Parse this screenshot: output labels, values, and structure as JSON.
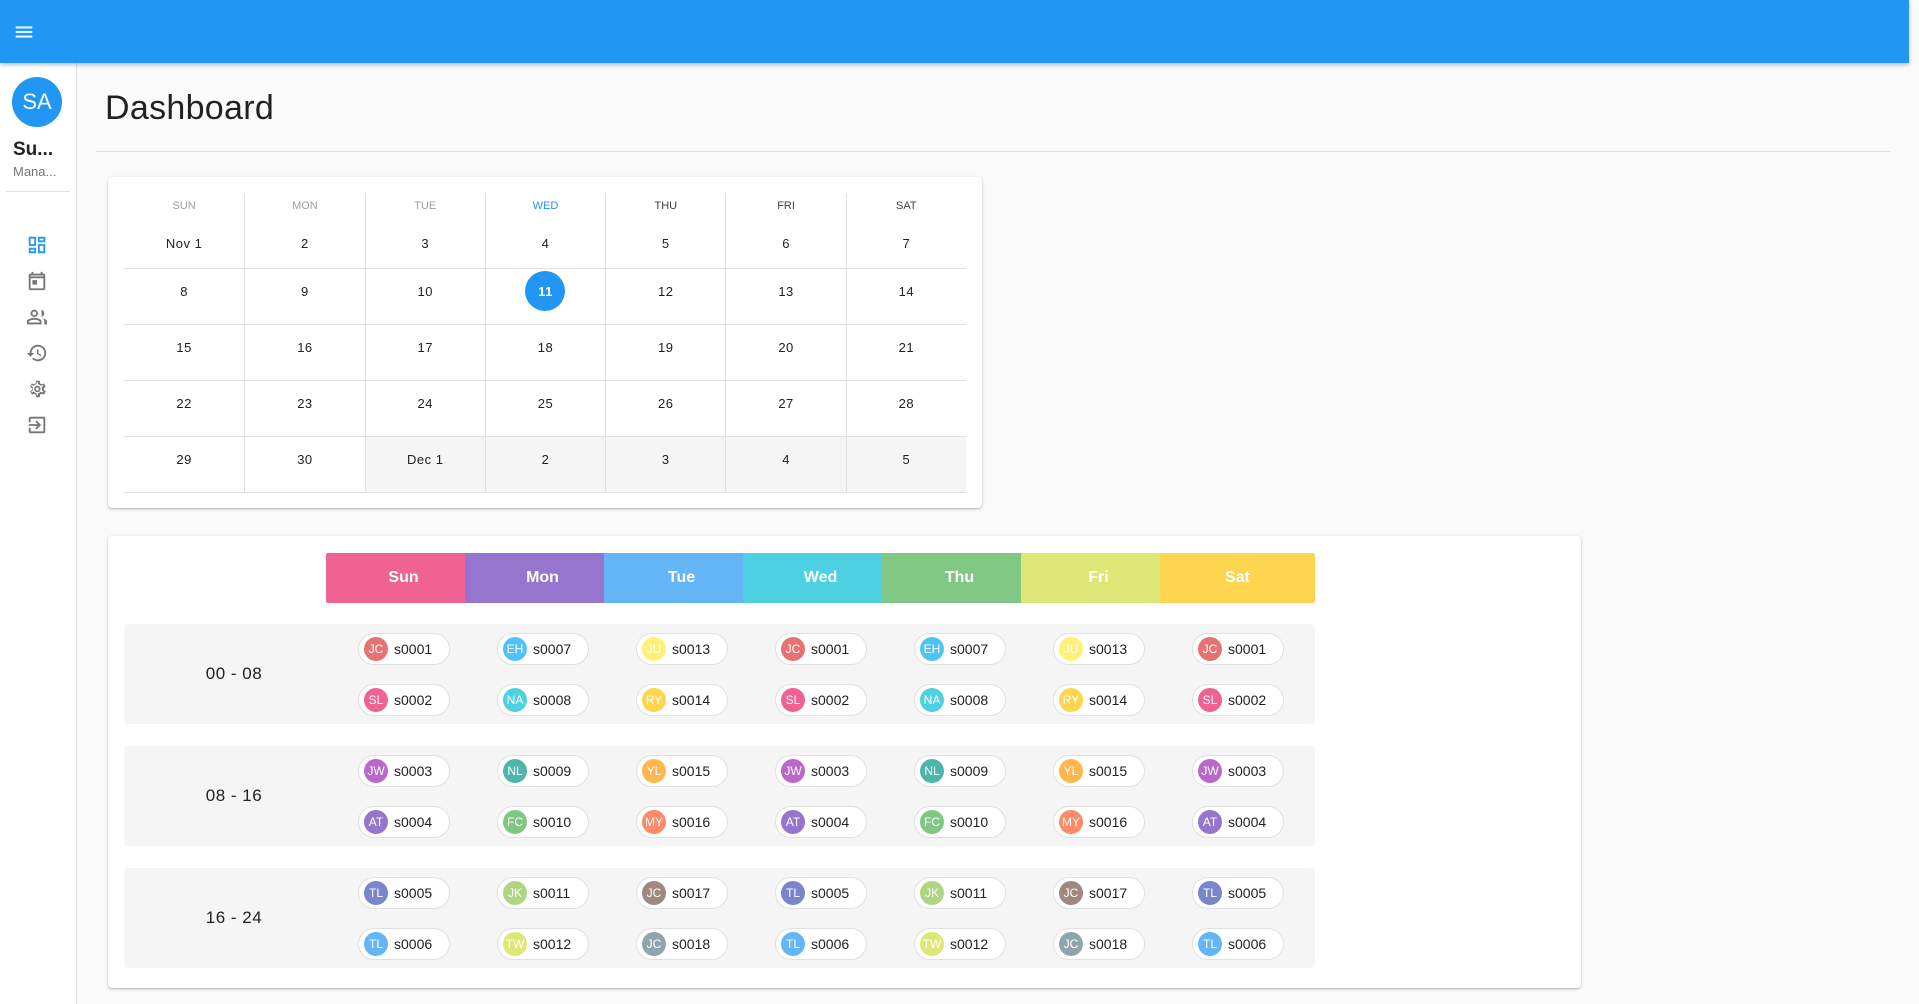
{
  "appbar": {
    "color": "#2196f3",
    "menu_icon": "menu-icon"
  },
  "user": {
    "initials": "SA",
    "name": "Su...",
    "role": "Mana..."
  },
  "nav": [
    {
      "icon": "dashboard-icon",
      "active": true
    },
    {
      "icon": "calendar-icon"
    },
    {
      "icon": "people-icon"
    },
    {
      "icon": "history-icon"
    },
    {
      "icon": "settings-icon"
    },
    {
      "icon": "logout-icon"
    }
  ],
  "page": {
    "title": "Dashboard"
  },
  "calendar": {
    "weekdays": [
      "SUN",
      "MON",
      "TUE",
      "WED",
      "THU",
      "FRI",
      "SAT"
    ],
    "today_weekday_index": 3,
    "selected": "11",
    "rows": [
      [
        "Nov 1",
        "2",
        "3",
        "4",
        "5",
        "6",
        "7"
      ],
      [
        "8",
        "9",
        "10",
        "11",
        "12",
        "13",
        "14"
      ],
      [
        "15",
        "16",
        "17",
        "18",
        "19",
        "20",
        "21"
      ],
      [
        "22",
        "23",
        "24",
        "25",
        "26",
        "27",
        "28"
      ],
      [
        "29",
        "30",
        "Dec 1",
        "2",
        "3",
        "4",
        "5"
      ]
    ],
    "outside_month_row4_from_col": 2
  },
  "schedule": {
    "days": [
      {
        "label": "Sun",
        "color": "#f06292"
      },
      {
        "label": "Mon",
        "color": "#9575cd"
      },
      {
        "label": "Tue",
        "color": "#64b5f6"
      },
      {
        "label": "Wed",
        "color": "#4dd0e1"
      },
      {
        "label": "Thu",
        "color": "#81c784"
      },
      {
        "label": "Fri",
        "color": "#dce775"
      },
      {
        "label": "Sat",
        "color": "#ffd54f"
      }
    ],
    "shifts": [
      {
        "label": "00 - 08",
        "cells": [
          [
            {
              "initials": "JC",
              "code": "s0001",
              "color": "#e57373"
            },
            {
              "initials": "SL",
              "code": "s0002",
              "color": "#f06292"
            }
          ],
          [
            {
              "initials": "EH",
              "code": "s0007",
              "color": "#4fc3f7"
            },
            {
              "initials": "NA",
              "code": "s0008",
              "color": "#4dd0e1"
            }
          ],
          [
            {
              "initials": "JU",
              "code": "s0013",
              "color": "#fff176"
            },
            {
              "initials": "RY",
              "code": "s0014",
              "color": "#ffd54f"
            }
          ],
          [
            {
              "initials": "JC",
              "code": "s0001",
              "color": "#e57373"
            },
            {
              "initials": "SL",
              "code": "s0002",
              "color": "#f06292"
            }
          ],
          [
            {
              "initials": "EH",
              "code": "s0007",
              "color": "#4fc3f7"
            },
            {
              "initials": "NA",
              "code": "s0008",
              "color": "#4dd0e1"
            }
          ],
          [
            {
              "initials": "JU",
              "code": "s0013",
              "color": "#fff176"
            },
            {
              "initials": "RY",
              "code": "s0014",
              "color": "#ffd54f"
            }
          ],
          [
            {
              "initials": "JC",
              "code": "s0001",
              "color": "#e57373"
            },
            {
              "initials": "SL",
              "code": "s0002",
              "color": "#f06292"
            }
          ]
        ]
      },
      {
        "label": "08 - 16",
        "cells": [
          [
            {
              "initials": "JW",
              "code": "s0003",
              "color": "#ba68c8"
            },
            {
              "initials": "AT",
              "code": "s0004",
              "color": "#9575cd"
            }
          ],
          [
            {
              "initials": "NL",
              "code": "s0009",
              "color": "#4db6ac"
            },
            {
              "initials": "FC",
              "code": "s0010",
              "color": "#81c784"
            }
          ],
          [
            {
              "initials": "YL",
              "code": "s0015",
              "color": "#ffb74d"
            },
            {
              "initials": "MY",
              "code": "s0016",
              "color": "#ff8a65"
            }
          ],
          [
            {
              "initials": "JW",
              "code": "s0003",
              "color": "#ba68c8"
            },
            {
              "initials": "AT",
              "code": "s0004",
              "color": "#9575cd"
            }
          ],
          [
            {
              "initials": "NL",
              "code": "s0009",
              "color": "#4db6ac"
            },
            {
              "initials": "FC",
              "code": "s0010",
              "color": "#81c784"
            }
          ],
          [
            {
              "initials": "YL",
              "code": "s0015",
              "color": "#ffb74d"
            },
            {
              "initials": "MY",
              "code": "s0016",
              "color": "#ff8a65"
            }
          ],
          [
            {
              "initials": "JW",
              "code": "s0003",
              "color": "#ba68c8"
            },
            {
              "initials": "AT",
              "code": "s0004",
              "color": "#9575cd"
            }
          ]
        ]
      },
      {
        "label": "16 - 24",
        "cells": [
          [
            {
              "initials": "TL",
              "code": "s0005",
              "color": "#7986cb"
            },
            {
              "initials": "TL",
              "code": "s0006",
              "color": "#64b5f6"
            }
          ],
          [
            {
              "initials": "JK",
              "code": "s0011",
              "color": "#aed581"
            },
            {
              "initials": "TW",
              "code": "s0012",
              "color": "#dce775"
            }
          ],
          [
            {
              "initials": "JC",
              "code": "s0017",
              "color": "#a1887f"
            },
            {
              "initials": "JC",
              "code": "s0018",
              "color": "#90a4ae"
            }
          ],
          [
            {
              "initials": "TL",
              "code": "s0005",
              "color": "#7986cb"
            },
            {
              "initials": "TL",
              "code": "s0006",
              "color": "#64b5f6"
            }
          ],
          [
            {
              "initials": "JK",
              "code": "s0011",
              "color": "#aed581"
            },
            {
              "initials": "TW",
              "code": "s0012",
              "color": "#dce775"
            }
          ],
          [
            {
              "initials": "JC",
              "code": "s0017",
              "color": "#a1887f"
            },
            {
              "initials": "JC",
              "code": "s0018",
              "color": "#90a4ae"
            }
          ],
          [
            {
              "initials": "TL",
              "code": "s0005",
              "color": "#7986cb"
            },
            {
              "initials": "TL",
              "code": "s0006",
              "color": "#64b5f6"
            }
          ]
        ]
      }
    ]
  }
}
